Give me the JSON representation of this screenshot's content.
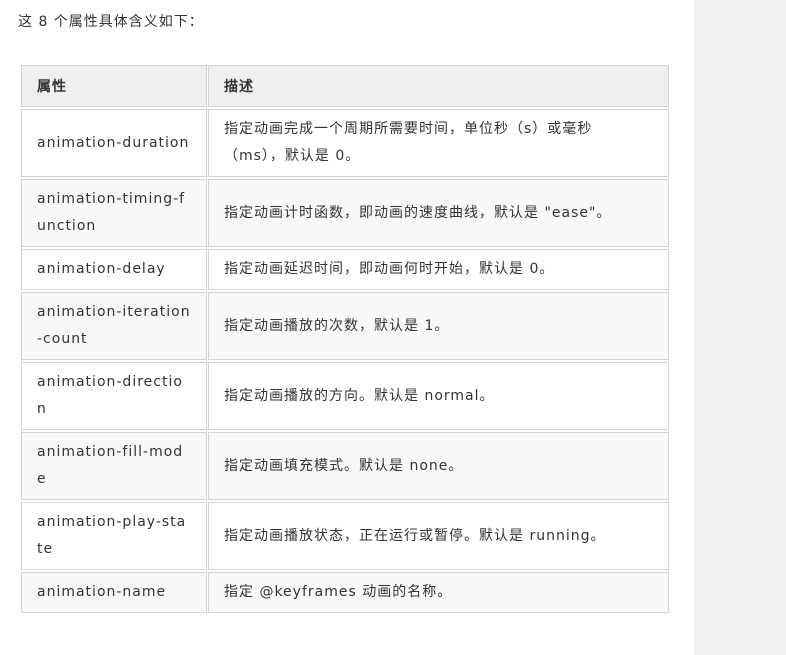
{
  "intro": "这 8 个属性具体含义如下：",
  "table": {
    "headers": [
      "属性",
      "描述"
    ],
    "rows": [
      {
        "property": "animation-duration",
        "description": "指定动画完成一个周期所需要时间，单位秒（s）或毫秒（ms），默认是 0。"
      },
      {
        "property": "animation-timing-function",
        "description": "指定动画计时函数，即动画的速度曲线，默认是 \"ease\"。"
      },
      {
        "property": "animation-delay",
        "description": "指定动画延迟时间，即动画何时开始，默认是 0。"
      },
      {
        "property": "animation-iteration-count",
        "description": "指定动画播放的次数，默认是 1。"
      },
      {
        "property": "animation-direction",
        "description": "指定动画播放的方向。默认是 normal。"
      },
      {
        "property": "animation-fill-mode",
        "description": "指定动画填充模式。默认是 none。"
      },
      {
        "property": "animation-play-state",
        "description": "指定动画播放状态，正在运行或暂停。默认是 running。"
      },
      {
        "property": "animation-name",
        "description": "指定 @keyframes 动画的名称。"
      }
    ]
  }
}
